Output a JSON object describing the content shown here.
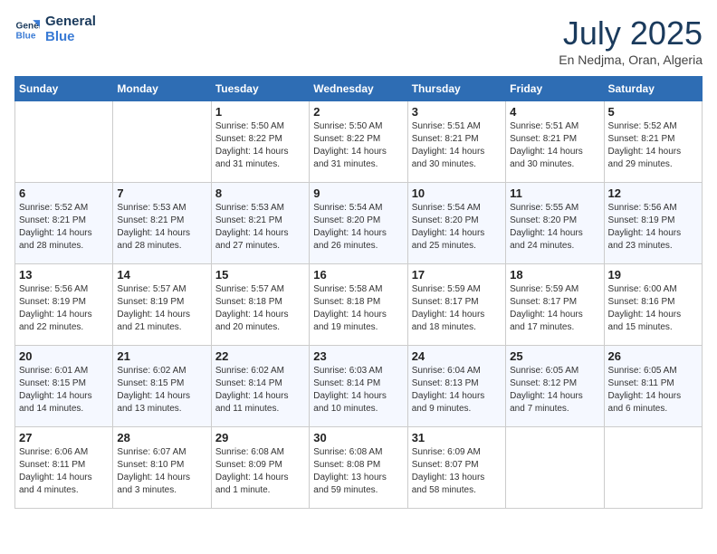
{
  "logo": {
    "line1": "General",
    "line2": "Blue"
  },
  "title": "July 2025",
  "subtitle": "En Nedjma, Oran, Algeria",
  "days_of_week": [
    "Sunday",
    "Monday",
    "Tuesday",
    "Wednesday",
    "Thursday",
    "Friday",
    "Saturday"
  ],
  "weeks": [
    [
      {
        "day": "",
        "info": ""
      },
      {
        "day": "",
        "info": ""
      },
      {
        "day": "1",
        "info": "Sunrise: 5:50 AM\nSunset: 8:22 PM\nDaylight: 14 hours and 31 minutes."
      },
      {
        "day": "2",
        "info": "Sunrise: 5:50 AM\nSunset: 8:22 PM\nDaylight: 14 hours and 31 minutes."
      },
      {
        "day": "3",
        "info": "Sunrise: 5:51 AM\nSunset: 8:21 PM\nDaylight: 14 hours and 30 minutes."
      },
      {
        "day": "4",
        "info": "Sunrise: 5:51 AM\nSunset: 8:21 PM\nDaylight: 14 hours and 30 minutes."
      },
      {
        "day": "5",
        "info": "Sunrise: 5:52 AM\nSunset: 8:21 PM\nDaylight: 14 hours and 29 minutes."
      }
    ],
    [
      {
        "day": "6",
        "info": "Sunrise: 5:52 AM\nSunset: 8:21 PM\nDaylight: 14 hours and 28 minutes."
      },
      {
        "day": "7",
        "info": "Sunrise: 5:53 AM\nSunset: 8:21 PM\nDaylight: 14 hours and 28 minutes."
      },
      {
        "day": "8",
        "info": "Sunrise: 5:53 AM\nSunset: 8:21 PM\nDaylight: 14 hours and 27 minutes."
      },
      {
        "day": "9",
        "info": "Sunrise: 5:54 AM\nSunset: 8:20 PM\nDaylight: 14 hours and 26 minutes."
      },
      {
        "day": "10",
        "info": "Sunrise: 5:54 AM\nSunset: 8:20 PM\nDaylight: 14 hours and 25 minutes."
      },
      {
        "day": "11",
        "info": "Sunrise: 5:55 AM\nSunset: 8:20 PM\nDaylight: 14 hours and 24 minutes."
      },
      {
        "day": "12",
        "info": "Sunrise: 5:56 AM\nSunset: 8:19 PM\nDaylight: 14 hours and 23 minutes."
      }
    ],
    [
      {
        "day": "13",
        "info": "Sunrise: 5:56 AM\nSunset: 8:19 PM\nDaylight: 14 hours and 22 minutes."
      },
      {
        "day": "14",
        "info": "Sunrise: 5:57 AM\nSunset: 8:19 PM\nDaylight: 14 hours and 21 minutes."
      },
      {
        "day": "15",
        "info": "Sunrise: 5:57 AM\nSunset: 8:18 PM\nDaylight: 14 hours and 20 minutes."
      },
      {
        "day": "16",
        "info": "Sunrise: 5:58 AM\nSunset: 8:18 PM\nDaylight: 14 hours and 19 minutes."
      },
      {
        "day": "17",
        "info": "Sunrise: 5:59 AM\nSunset: 8:17 PM\nDaylight: 14 hours and 18 minutes."
      },
      {
        "day": "18",
        "info": "Sunrise: 5:59 AM\nSunset: 8:17 PM\nDaylight: 14 hours and 17 minutes."
      },
      {
        "day": "19",
        "info": "Sunrise: 6:00 AM\nSunset: 8:16 PM\nDaylight: 14 hours and 15 minutes."
      }
    ],
    [
      {
        "day": "20",
        "info": "Sunrise: 6:01 AM\nSunset: 8:15 PM\nDaylight: 14 hours and 14 minutes."
      },
      {
        "day": "21",
        "info": "Sunrise: 6:02 AM\nSunset: 8:15 PM\nDaylight: 14 hours and 13 minutes."
      },
      {
        "day": "22",
        "info": "Sunrise: 6:02 AM\nSunset: 8:14 PM\nDaylight: 14 hours and 11 minutes."
      },
      {
        "day": "23",
        "info": "Sunrise: 6:03 AM\nSunset: 8:14 PM\nDaylight: 14 hours and 10 minutes."
      },
      {
        "day": "24",
        "info": "Sunrise: 6:04 AM\nSunset: 8:13 PM\nDaylight: 14 hours and 9 minutes."
      },
      {
        "day": "25",
        "info": "Sunrise: 6:05 AM\nSunset: 8:12 PM\nDaylight: 14 hours and 7 minutes."
      },
      {
        "day": "26",
        "info": "Sunrise: 6:05 AM\nSunset: 8:11 PM\nDaylight: 14 hours and 6 minutes."
      }
    ],
    [
      {
        "day": "27",
        "info": "Sunrise: 6:06 AM\nSunset: 8:11 PM\nDaylight: 14 hours and 4 minutes."
      },
      {
        "day": "28",
        "info": "Sunrise: 6:07 AM\nSunset: 8:10 PM\nDaylight: 14 hours and 3 minutes."
      },
      {
        "day": "29",
        "info": "Sunrise: 6:08 AM\nSunset: 8:09 PM\nDaylight: 14 hours and 1 minute."
      },
      {
        "day": "30",
        "info": "Sunrise: 6:08 AM\nSunset: 8:08 PM\nDaylight: 13 hours and 59 minutes."
      },
      {
        "day": "31",
        "info": "Sunrise: 6:09 AM\nSunset: 8:07 PM\nDaylight: 13 hours and 58 minutes."
      },
      {
        "day": "",
        "info": ""
      },
      {
        "day": "",
        "info": ""
      }
    ]
  ]
}
